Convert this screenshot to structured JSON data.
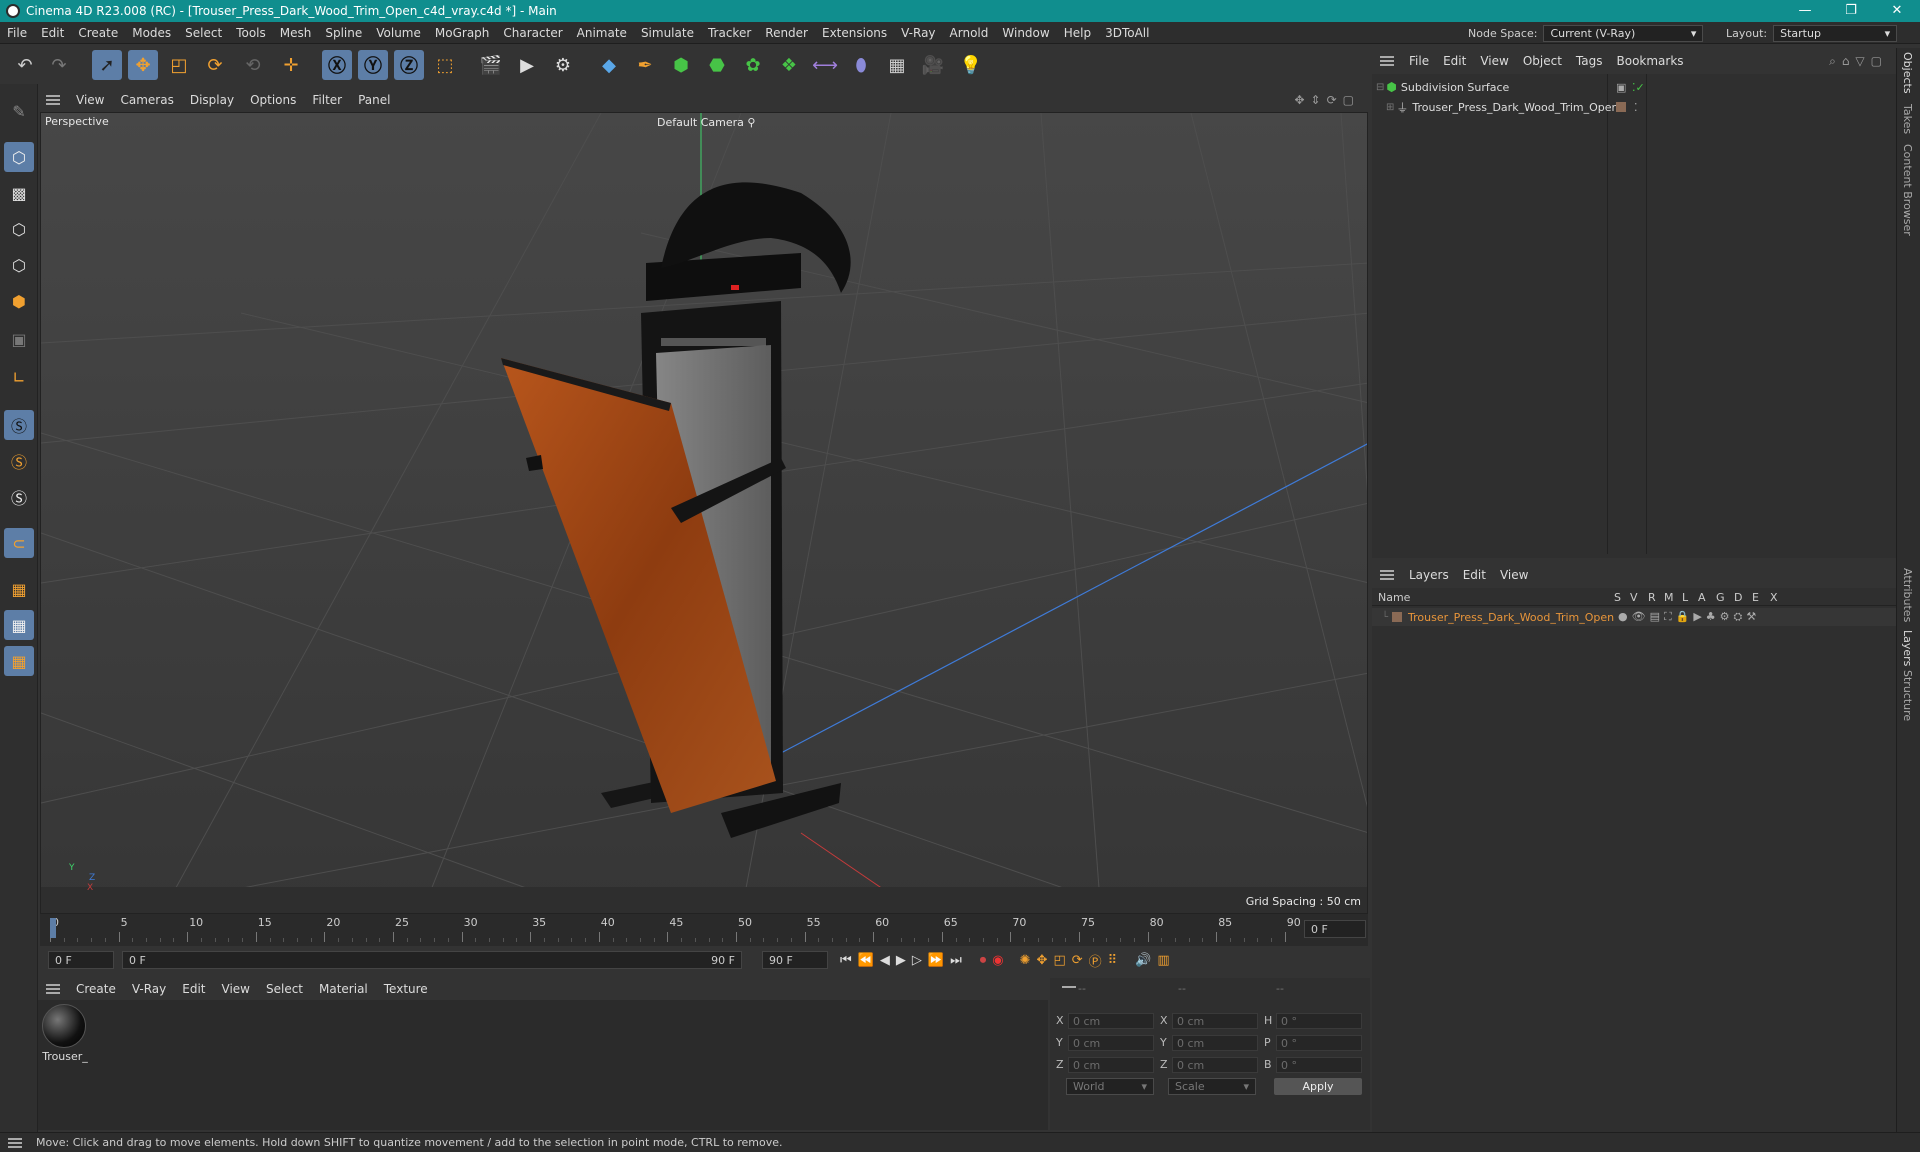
{
  "window": {
    "title": "Cinema 4D R23.008 (RC) - [Trouser_Press_Dark_Wood_Trim_Open_c4d_vray.c4d *] - Main",
    "controls": [
      "—",
      "❐",
      "✕"
    ]
  },
  "menubar": {
    "items": [
      "File",
      "Edit",
      "Create",
      "Modes",
      "Select",
      "Tools",
      "Mesh",
      "Spline",
      "Volume",
      "MoGraph",
      "Character",
      "Animate",
      "Simulate",
      "Tracker",
      "Render",
      "Extensions",
      "V-Ray",
      "Arnold",
      "Window",
      "Help",
      "3DToAll"
    ],
    "node_space_label": "Node Space:",
    "node_space_value": "Current (V-Ray)",
    "layout_label": "Layout:",
    "layout_value": "Startup"
  },
  "viewport": {
    "menu": [
      "View",
      "Cameras",
      "Display",
      "Options",
      "Filter",
      "Panel"
    ],
    "label": "Perspective",
    "camera": "Default Camera",
    "grid_spacing": "Grid Spacing : 50 cm",
    "axis_y": "Y",
    "axis_z": "Z",
    "axis_x": "X"
  },
  "timeline": {
    "ticks": [
      "0",
      "5",
      "10",
      "15",
      "20",
      "25",
      "30",
      "35",
      "40",
      "45",
      "50",
      "55",
      "60",
      "65",
      "70",
      "75",
      "80",
      "85",
      "90"
    ],
    "current_frame": "0 F",
    "start_field": "0 F",
    "range_start": "0 F",
    "range_end": "90 F",
    "end_field": "90 F"
  },
  "material_manager": {
    "menu": [
      "Create",
      "V-Ray",
      "Edit",
      "View",
      "Select",
      "Material",
      "Texture"
    ],
    "materials": [
      {
        "name": "Trouser_"
      }
    ]
  },
  "coordinates": {
    "headers": [
      "--",
      "--",
      "--"
    ],
    "rows": [
      {
        "l1": "X",
        "v1": "0 cm",
        "l2": "X",
        "v2": "0 cm",
        "l3": "H",
        "v3": "0 °"
      },
      {
        "l1": "Y",
        "v1": "0 cm",
        "l2": "Y",
        "v2": "0 cm",
        "l3": "P",
        "v3": "0 °"
      },
      {
        "l1": "Z",
        "v1": "0 cm",
        "l2": "Z",
        "v2": "0 cm",
        "l3": "B",
        "v3": "0 °"
      }
    ],
    "coord_system": "World",
    "mode": "Scale",
    "apply": "Apply"
  },
  "object_manager": {
    "menu": [
      "File",
      "Edit",
      "View",
      "Object",
      "Tags",
      "Bookmarks"
    ],
    "objects": [
      {
        "name": "Subdivision Surface"
      },
      {
        "name": "Trouser_Press_Dark_Wood_Trim_Open"
      }
    ]
  },
  "layers_manager": {
    "menu": [
      "Layers",
      "Edit",
      "View"
    ],
    "columns": [
      "Name",
      "S",
      "V",
      "R",
      "M",
      "L",
      "A",
      "G",
      "D",
      "E",
      "X"
    ],
    "layers": [
      {
        "name": "Trouser_Press_Dark_Wood_Trim_Open"
      }
    ]
  },
  "right_tabs": [
    "Objects",
    "Takes",
    "Content Browser",
    "Attributes",
    "Layers",
    "Structure"
  ],
  "status": "Move: Click and drag to move elements. Hold down SHIFT to quantize movement / add to the selection in point mode, CTRL to remove.",
  "colors": {
    "titlebar": "#108e8e",
    "accent": "#5d7ea7",
    "layer_orange": "#e8953a"
  }
}
